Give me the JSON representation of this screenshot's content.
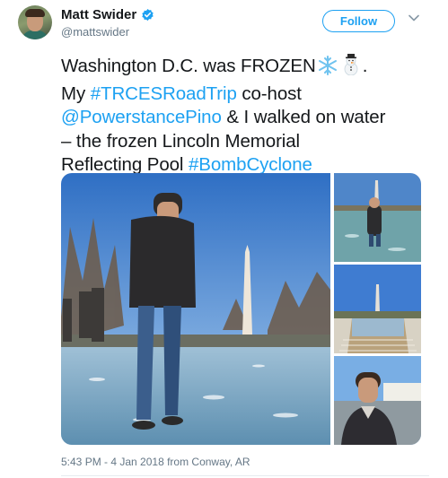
{
  "tweet": {
    "author_name": "Matt Swider",
    "author_handle": "@mattswider",
    "follow_label": "Follow",
    "text": {
      "l1_a": "Washington D.C. was FROZEN",
      "l1_b": ".",
      "l2_a": "My ",
      "hashtag1": "#TRCESRoadTrip",
      "l2_b": " co-host",
      "mention": "@PowerstancePino",
      "l3_b": " & I walked on water",
      "l4": "– the frozen Lincoln Memorial",
      "l5_a": "Reflecting Pool ",
      "hashtag2": "#BombCyclone"
    },
    "timestamp": "5:43 PM - 4 Jan 2018 from Conway, AR"
  },
  "icons": {
    "verified": "verified-badge-icon",
    "menu": "chevron-down-icon",
    "emoji_1": "snowflake-icon",
    "emoji_2": "snowman-icon"
  },
  "colors": {
    "link": "#1da1f2",
    "text": "#14171a",
    "secondary": "#657786"
  }
}
